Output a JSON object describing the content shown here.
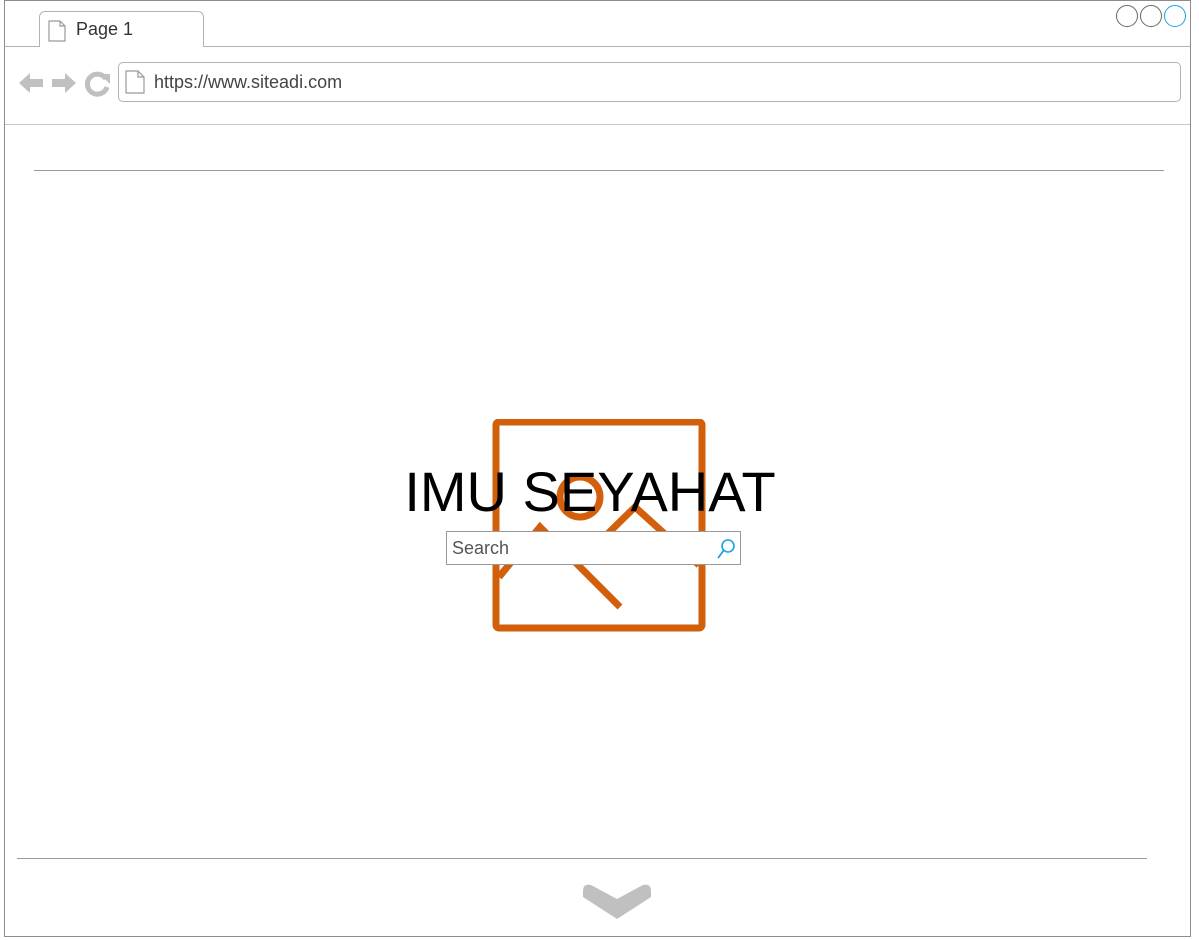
{
  "browser": {
    "tab_title": "Page 1",
    "url": "https://www.siteadi.com"
  },
  "icons": {
    "tab": "page-icon",
    "back": "arrow-left-icon",
    "forward": "arrow-right-icon",
    "reload": "reload-icon",
    "address": "page-icon",
    "search": "search-icon",
    "hero": "image-placeholder-icon",
    "scroll": "chevron-down-icon"
  },
  "colors": {
    "accent": "#1ba1e2",
    "placeholder_image": "#d35f0a",
    "nav_icons": "#c0c0c0"
  },
  "page": {
    "title": "IMU SEYAHAT",
    "search": {
      "placeholder": "Search",
      "value": ""
    }
  }
}
